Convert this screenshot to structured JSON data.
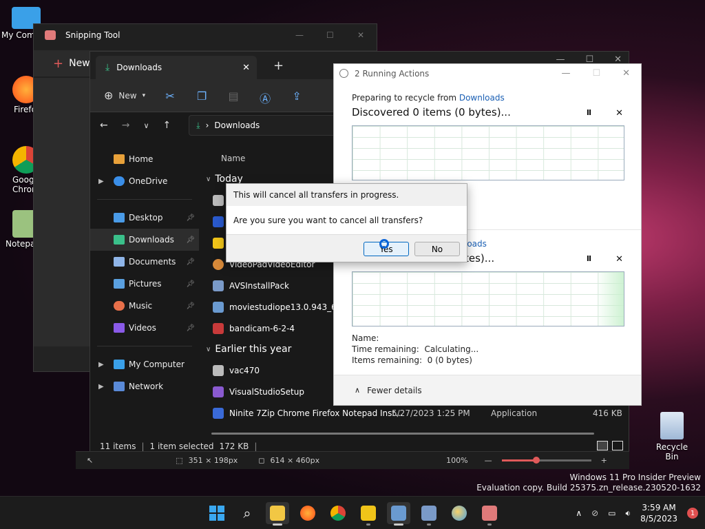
{
  "desktop": {
    "icons": [
      {
        "label": "My Com",
        "color": "#3aa0e8"
      },
      {
        "label": "Firefo",
        "color": "#ff6a1a"
      },
      {
        "label": "Goog Chron",
        "color": "#4285f4"
      },
      {
        "label": "Notepa",
        "color": "#6aa84f"
      }
    ],
    "recycle_label": "Recycle Bin"
  },
  "snipping": {
    "title": "Snipping Tool",
    "new_label": "New",
    "status": {
      "size1": "351 × 198px",
      "size2": "614 × 460px",
      "zoom": "100%"
    }
  },
  "explorer": {
    "tab_label": "Downloads",
    "toolbar": {
      "new_label": "New"
    },
    "address": "Downloads",
    "sidebar": [
      {
        "label": "Home",
        "icon": "home-icon",
        "color": "#e8a13a"
      },
      {
        "label": "OneDrive",
        "icon": "cloud-icon",
        "color": "#3a8ee8",
        "chevron": true
      },
      {
        "label": "Desktop",
        "icon": "desktop-icon",
        "color": "#4a9be8",
        "pin": true
      },
      {
        "label": "Downloads",
        "icon": "download-icon",
        "color": "#3ac08a",
        "pin": true,
        "selected": true
      },
      {
        "label": "Documents",
        "icon": "document-icon",
        "color": "#8fb5e8",
        "pin": true
      },
      {
        "label": "Pictures",
        "icon": "pictures-icon",
        "color": "#5aa0e0",
        "pin": true
      },
      {
        "label": "Music",
        "icon": "music-icon",
        "color": "#e8704a",
        "pin": true
      },
      {
        "label": "Videos",
        "icon": "videos-icon",
        "color": "#8a5ae8",
        "pin": true
      },
      {
        "label": "My Computer",
        "icon": "computer-icon",
        "color": "#3aa0e8",
        "chevron": true
      },
      {
        "label": "Network",
        "icon": "network-icon",
        "color": "#5a8ad8",
        "chevron": true
      }
    ],
    "column_name": "Name",
    "group_today": "Today",
    "group_earlier": "Earlier this year",
    "files_today": [
      {
        "name": "",
        "color": "#bbb"
      },
      {
        "name": "",
        "color": "#2a5acd"
      },
      {
        "name": "",
        "color": "#f0c419"
      },
      {
        "name": "VideoPadVideoEditor",
        "color": "#d88a3a"
      },
      {
        "name": "AVSInstallPack",
        "color": "#7a9ac8"
      },
      {
        "name": "moviestudiope13.0.943_64bit",
        "color": "#6a9ad0"
      },
      {
        "name": "bandicam-6-2-4",
        "color": "#c83a3a"
      }
    ],
    "files_earlier": [
      {
        "name": "vac470",
        "color": "#bbb"
      },
      {
        "name": "VisualStudioSetup",
        "color": "#8a5ad0"
      },
      {
        "name": "Ninite 7Zip Chrome Firefox Notepad Inst...",
        "color": "#3a6ad8",
        "date": "5/27/2023 1:25 PM",
        "type": "Application",
        "size": "416 KB"
      }
    ],
    "status": {
      "count": "11 items",
      "selected": "1 item selected",
      "size": "172 KB"
    }
  },
  "actions": {
    "title": "2 Running Actions",
    "op1": {
      "from_prefix": "Preparing to recycle from ",
      "from_link": "Downloads",
      "head": "Discovered 0 items (0 bytes)..."
    },
    "op2": {
      "from_link": "loads",
      "head": "tes)..."
    },
    "details": {
      "name_label": "Name:",
      "time_label": "Time remaining:",
      "time_value": "Calculating...",
      "items_label": "Items remaining:",
      "items_value": "0 (0 bytes)"
    },
    "fewer_details": "Fewer details",
    "pause_glyph": "II",
    "close_glyph": "✕"
  },
  "confirm": {
    "header": "This will cancel all transfers in progress.",
    "message": "Are you sure you want to cancel all transfers?",
    "yes_label": "Yes",
    "no_label": "No"
  },
  "watermark": {
    "line1": "Windows 11 Pro Insider Preview",
    "line2": "Evaluation copy. Build 25375.zn_release.230520-1632"
  },
  "taskbar": {
    "time": "3:59 AM",
    "date": "8/5/2023",
    "notifications": "1"
  }
}
